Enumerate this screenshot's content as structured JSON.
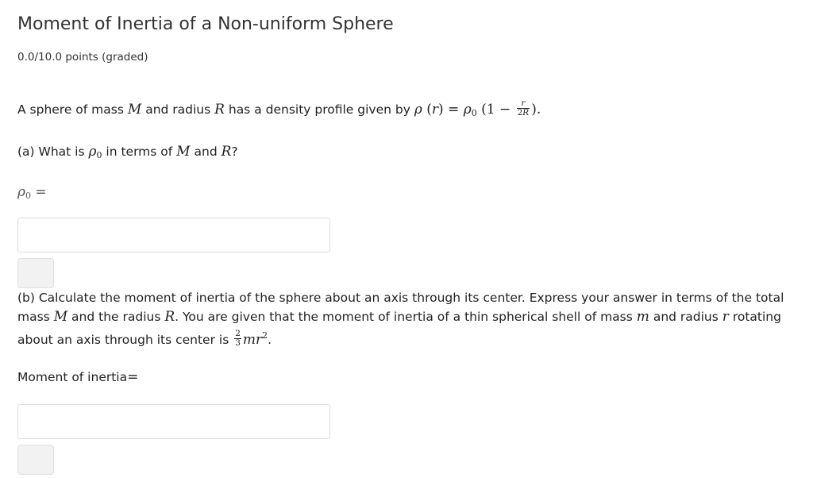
{
  "problem": {
    "title": "Moment of Inertia of a Non-uniform Sphere",
    "points": "0.0/10.0 points (graded)",
    "intro": {
      "t1": "A sphere of mass ",
      "M": "M",
      "t2": " and radius ",
      "R": "R",
      "t3": " has a density profile given by ",
      "rho": "ρ",
      "paren_r": "(r)",
      "eq": " = ",
      "rho0": "ρ",
      "sub0": "0",
      "open": " (1 − ",
      "frac_num": "r",
      "frac_den_2": "2",
      "frac_den_R": "R",
      "close": ").",
      "period": ""
    },
    "part_a": {
      "t1": "(a) What is ",
      "rho": "ρ",
      "sub0": "0",
      "t2": " in terms of ",
      "M": "M",
      "t3": " and ",
      "R": "R",
      "t4": "?",
      "answer_label_rho": "ρ",
      "answer_label_sub": "0",
      "answer_label_eq": " =",
      "input_value": "",
      "input_placeholder": ""
    },
    "part_b": {
      "l1": "(b) Calculate the moment of inertia of the sphere about an axis through its center. Express your answer in terms of the total",
      "l2_t1": "mass ",
      "l2_M": "M",
      "l2_t2": " and the radius ",
      "l2_R": "R",
      "l2_t3": ". You are given that the moment of inertia of a thin spherical shell of mass ",
      "l2_m": "m",
      "l2_t4": " and radius ",
      "l2_r": "r",
      "l2_t5": " rotating",
      "l3_t1": "about an axis through its center is ",
      "frac_num": "2",
      "frac_den": "3",
      "mr": "mr",
      "sup2": "2",
      "l3_t2": ".",
      "answer_label": "Moment of inertia",
      "answer_eq": "=",
      "input_value": "",
      "input_placeholder": ""
    }
  },
  "colors": {
    "input_border": "#dcdcdc",
    "button_bg": "#f2f2f2",
    "text": "#333333"
  }
}
